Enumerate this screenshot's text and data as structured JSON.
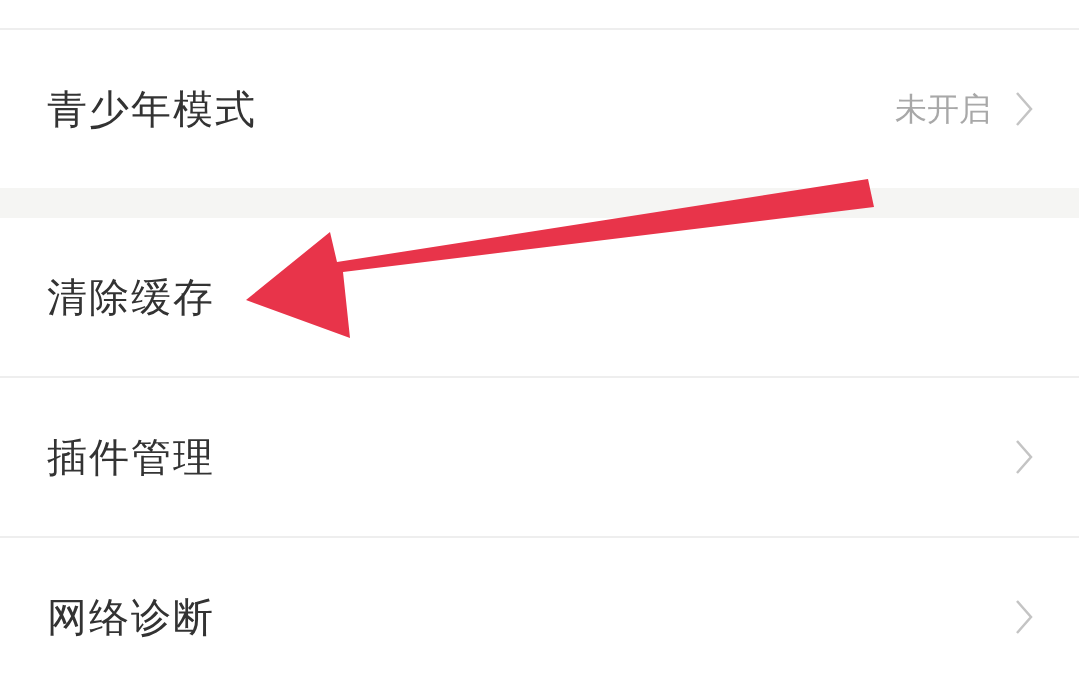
{
  "sections": [
    {
      "rows": [
        {
          "label": "青少年模式",
          "value": "未开启",
          "chevron": true
        }
      ]
    },
    {
      "rows": [
        {
          "label": "清除缓存",
          "chevron": false
        },
        {
          "label": "插件管理",
          "chevron": true
        },
        {
          "label": "网络诊断",
          "chevron": true
        }
      ]
    }
  ]
}
